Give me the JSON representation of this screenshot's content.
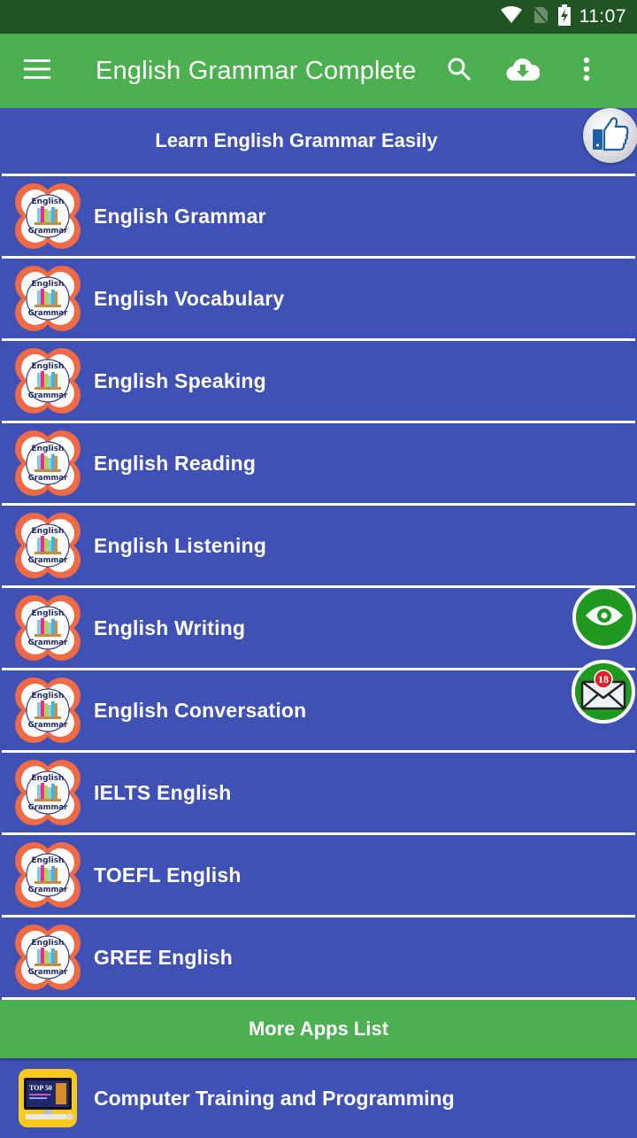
{
  "status_bar": {
    "time": "11:07",
    "icons": [
      "wifi-icon",
      "no-sim-icon",
      "battery-charging-icon"
    ]
  },
  "app_bar": {
    "menu_icon": "hamburger-menu-icon",
    "title": "English Grammar Complete",
    "actions": [
      {
        "name": "search",
        "icon": "search-icon"
      },
      {
        "name": "download",
        "icon": "cloud-download-icon"
      },
      {
        "name": "overflow",
        "icon": "more-vert-icon"
      }
    ]
  },
  "header": {
    "title": "Learn English Grammar Easily"
  },
  "list": {
    "items": [
      {
        "label": "English Grammar"
      },
      {
        "label": "English Vocabulary"
      },
      {
        "label": "English Speaking"
      },
      {
        "label": "English Reading"
      },
      {
        "label": "English Listening"
      },
      {
        "label": "English Writing"
      },
      {
        "label": "English Conversation"
      },
      {
        "label": "IELTS English"
      },
      {
        "label": "TOEFL English"
      },
      {
        "label": "GREE English"
      }
    ],
    "icon_text_top": "English",
    "icon_text_bottom": "Grammar"
  },
  "more_apps": {
    "title": "More Apps List",
    "items": [
      {
        "label": "Computer Training and Programming",
        "icon_text": "TOP 50"
      }
    ]
  },
  "floating": {
    "like_icon": "thumbs-up-icon",
    "eye_icon": "eye-icon",
    "mail_icon": "mail-icon",
    "mail_badge": "18"
  },
  "colors": {
    "status_bar": "#225524",
    "app_bar": "#4caf50",
    "list_bg": "#3f51b5",
    "fab_green": "#1f9a1f",
    "icon_orange": "#ef6a45"
  }
}
